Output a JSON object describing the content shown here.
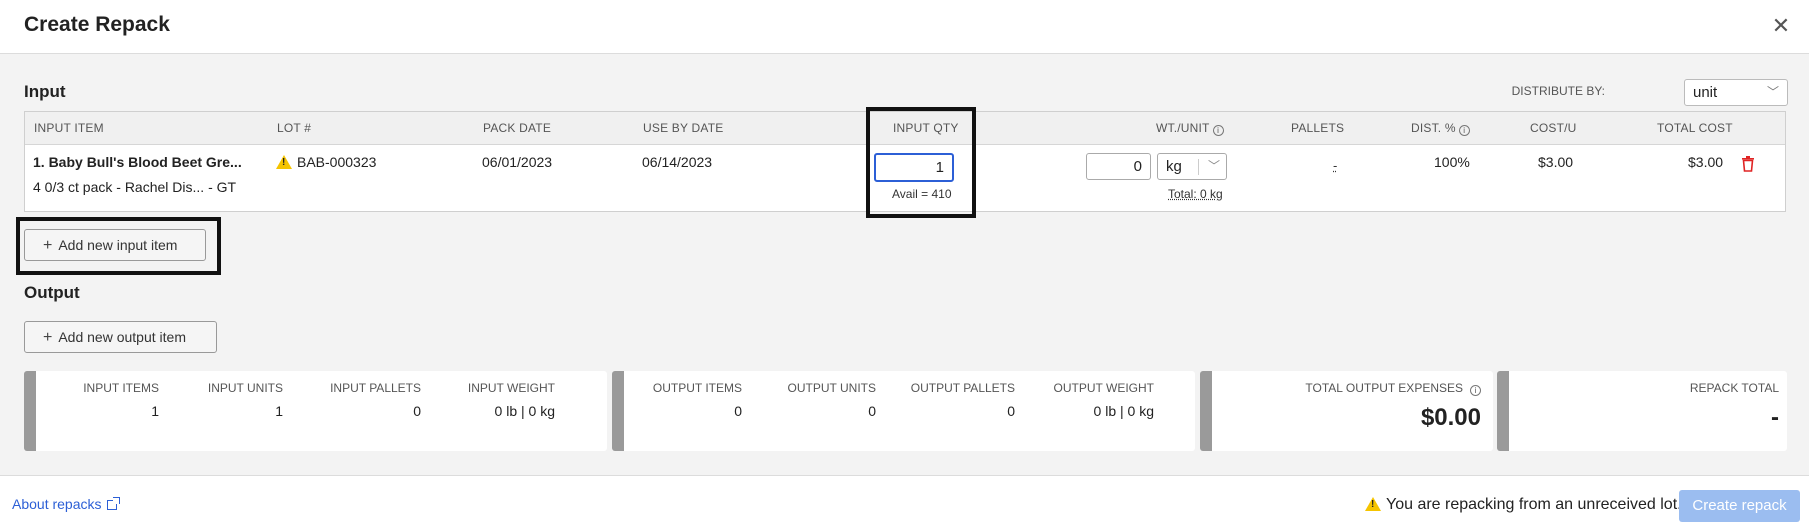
{
  "header": {
    "title": "Create Repack"
  },
  "input": {
    "section_label": "Input",
    "distribute_by_label": "DISTRIBUTE BY:",
    "distribute_by_value": "unit",
    "columns": {
      "input_item": "INPUT ITEM",
      "lot": "LOT #",
      "pack_date": "PACK DATE",
      "use_by_date": "USE BY DATE",
      "input_qty": "INPUT QTY",
      "wt_unit": "WT./UNIT",
      "pallets": "PALLETS",
      "dist_pct": "DIST. %",
      "cost_u": "COST/U",
      "total_cost": "TOTAL COST"
    },
    "row": {
      "item_name": "1. Baby Bull's Blood Beet Gre...",
      "item_desc": "4 0/3 ct pack - Rachel Dis... - GT",
      "lot": "BAB-000323",
      "pack_date": "06/01/2023",
      "use_by_date": "06/14/2023",
      "input_qty": "1",
      "avail": "Avail = 410",
      "wt_value": "0",
      "wt_unit": "kg",
      "total_weight": "Total: 0 kg",
      "pallets": "-",
      "dist_pct": "100%",
      "cost_u": "$3.00",
      "total_cost": "$3.00"
    },
    "add_button": "Add new input item"
  },
  "output": {
    "section_label": "Output",
    "add_button": "Add new output item"
  },
  "summary": {
    "input_items_label": "INPUT ITEMS",
    "input_items": "1",
    "input_units_label": "INPUT UNITS",
    "input_units": "1",
    "input_pallets_label": "INPUT PALLETS",
    "input_pallets": "0",
    "input_weight_label": "INPUT WEIGHT",
    "input_weight": "0 lb | 0 kg",
    "output_items_label": "OUTPUT ITEMS",
    "output_items": "0",
    "output_units_label": "OUTPUT UNITS",
    "output_units": "0",
    "output_pallets_label": "OUTPUT PALLETS",
    "output_pallets": "0",
    "output_weight_label": "OUTPUT WEIGHT",
    "output_weight": "0 lb | 0 kg",
    "total_output_expenses_label": "TOTAL OUTPUT EXPENSES",
    "total_output_expenses": "$0.00",
    "repack_total_label": "REPACK TOTAL",
    "repack_total": "-"
  },
  "footer": {
    "about_link": "About repacks",
    "warning": "You are repacking from an unreceived lot.",
    "create_button": "Create repack"
  },
  "colors": {
    "accent": "#2c5fd6",
    "create_disabled": "#9bbdf0",
    "warning": "#f5c400",
    "delete": "#e02424"
  }
}
